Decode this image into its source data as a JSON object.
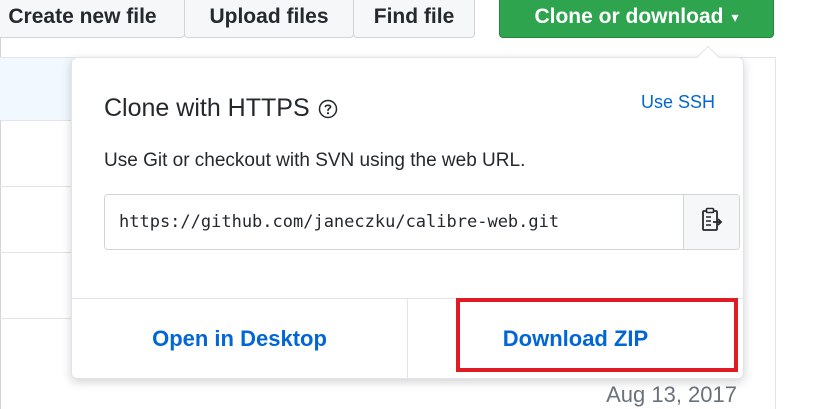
{
  "toolbar": {
    "create_label": "Create new file",
    "upload_label": "Upload files",
    "find_label": "Find file",
    "clone_label": "Clone or download",
    "clone_caret": "▾"
  },
  "dropdown": {
    "title": "Clone with HTTPS",
    "help_icon": "question-circle",
    "use_ssh": "Use SSH",
    "description": "Use Git or checkout with SVN using the web URL.",
    "url_value": "https://github.com/janeczku/calibre-web.git",
    "copy_icon": "clipboard",
    "open_desktop": "Open in Desktop",
    "download_zip": "Download ZIP"
  },
  "file_list": {
    "visible_date": "Aug 13, 2017"
  },
  "colors": {
    "clone_button": "#2ea44f",
    "link": "#0366d6",
    "highlight": "#e01b24"
  }
}
